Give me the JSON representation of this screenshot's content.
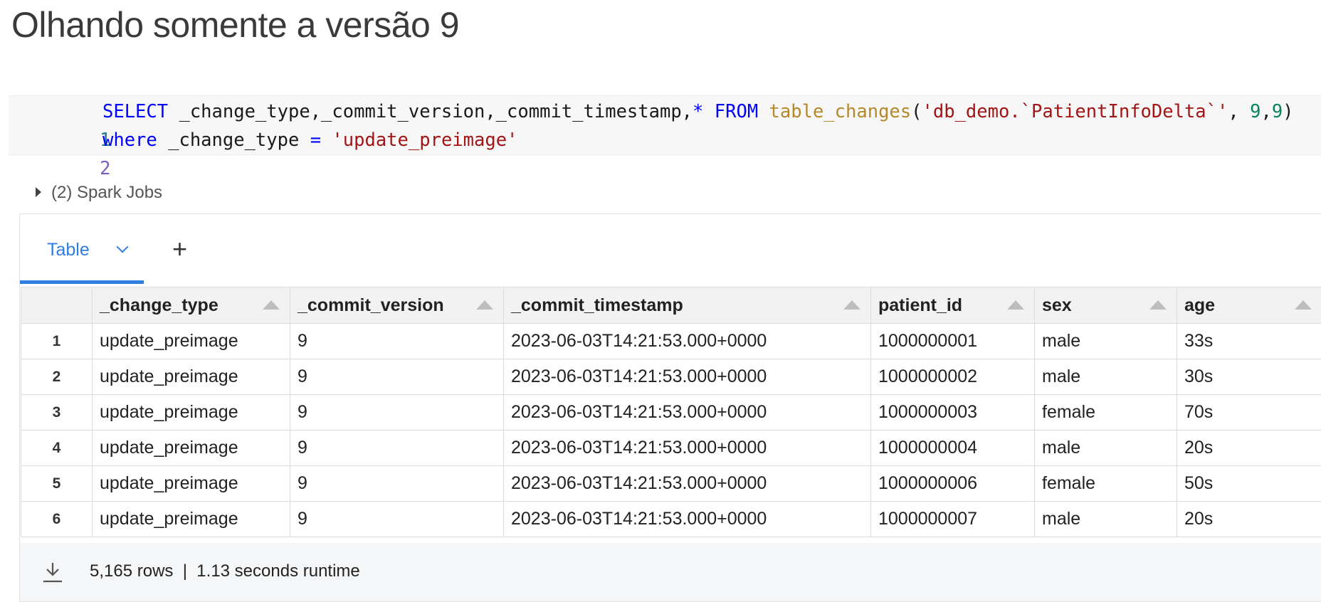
{
  "page": {
    "title": "Olhando somente a versão 9"
  },
  "code": {
    "lines": [
      {
        "number": "1"
      },
      {
        "number": "2"
      }
    ],
    "tokens": {
      "l1_select": "SELECT",
      "l1_cols": " _change_type,_commit_version,_commit_timestamp,",
      "l1_star": "*",
      "l1_from": "FROM",
      "l1_fn": "table_changes",
      "l1_paren_open": "(",
      "l1_str": "'db_demo.`PatientInfoDelta`'",
      "l1_comma": ", ",
      "l1_num1": "9",
      "l1_comma2": ",",
      "l1_num2": "9",
      "l1_paren_close": ")",
      "l2_where": "where",
      "l2_col": " _change_type ",
      "l2_eq": "=",
      "l2_str": "'update_preimage'"
    }
  },
  "jobs": {
    "label": "(2) Spark Jobs"
  },
  "tabs": {
    "active_label": "Table",
    "add_label": "+"
  },
  "table": {
    "columns": [
      "_change_type",
      "_commit_version",
      "_commit_timestamp",
      "patient_id",
      "sex",
      "age"
    ],
    "rows": [
      {
        "idx": "1",
        "cells": [
          "update_preimage",
          "9",
          "2023-06-03T14:21:53.000+0000",
          "1000000001",
          "male",
          "33s"
        ]
      },
      {
        "idx": "2",
        "cells": [
          "update_preimage",
          "9",
          "2023-06-03T14:21:53.000+0000",
          "1000000002",
          "male",
          "30s"
        ]
      },
      {
        "idx": "3",
        "cells": [
          "update_preimage",
          "9",
          "2023-06-03T14:21:53.000+0000",
          "1000000003",
          "female",
          "70s"
        ]
      },
      {
        "idx": "4",
        "cells": [
          "update_preimage",
          "9",
          "2023-06-03T14:21:53.000+0000",
          "1000000004",
          "male",
          "20s"
        ]
      },
      {
        "idx": "5",
        "cells": [
          "update_preimage",
          "9",
          "2023-06-03T14:21:53.000+0000",
          "1000000006",
          "female",
          "50s"
        ]
      },
      {
        "idx": "6",
        "cells": [
          "update_preimage",
          "9",
          "2023-06-03T14:21:53.000+0000",
          "1000000007",
          "male",
          "20s"
        ]
      }
    ]
  },
  "footer": {
    "summary": "5,165 rows  |  1.13 seconds runtime",
    "icon": "download-icon"
  },
  "colors": {
    "accent": "#2f7ee0",
    "keyword": "#0000ff",
    "function": "#b5892b",
    "string": "#a31515",
    "number": "#098658"
  }
}
